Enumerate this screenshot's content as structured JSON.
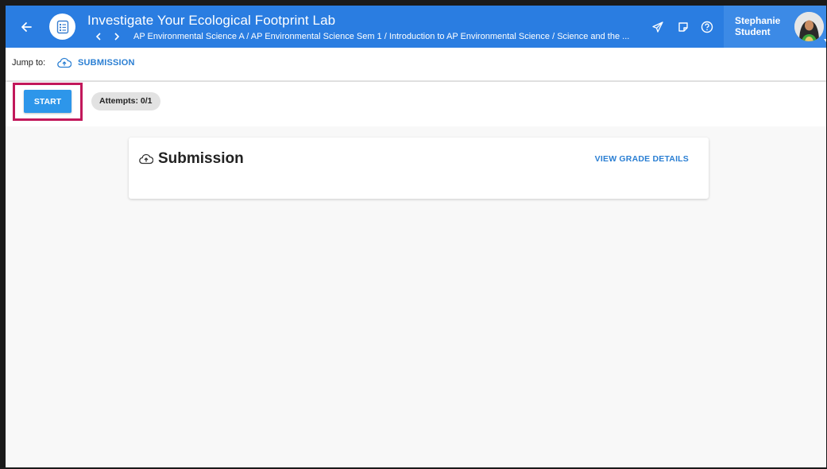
{
  "header": {
    "title": "Investigate Your Ecological Footprint Lab",
    "breadcrumb": "AP Environmental Science A / AP Environmental Science Sem 1 / Introduction to AP Environmental Science / Science and the ...",
    "bg_color": "#2a7de1"
  },
  "user": {
    "first_name": "Stephanie",
    "last_name": "Student"
  },
  "jump": {
    "label": "Jump to:",
    "link_label": "SUBMISSION"
  },
  "actions": {
    "start_label": "START",
    "attempts_label": "Attempts: 0/1",
    "highlight_color": "#c2185b"
  },
  "card": {
    "title": "Submission",
    "grade_link_label": "VIEW GRADE DETAILS"
  },
  "icons": {
    "back": "arrow-left-icon",
    "activity": "document-list-icon",
    "prev": "chevron-left-icon",
    "next": "chevron-right-icon",
    "send": "paper-plane-icon",
    "notes": "note-icon",
    "help": "help-circle-icon",
    "upload": "cloud-upload-icon"
  }
}
